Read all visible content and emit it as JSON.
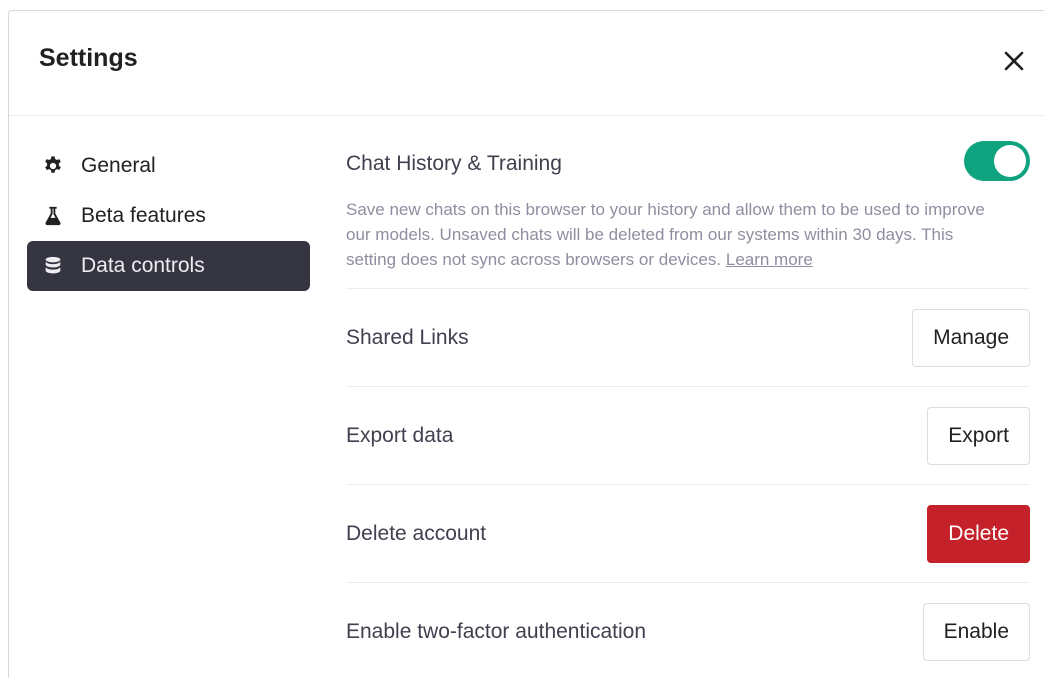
{
  "dialog": {
    "title": "Settings",
    "close_icon": "close-icon"
  },
  "sidebar": {
    "items": [
      {
        "label": "General",
        "icon": "gear-icon",
        "active": false
      },
      {
        "label": "Beta features",
        "icon": "flask-icon",
        "active": false
      },
      {
        "label": "Data controls",
        "icon": "database-icon",
        "active": true
      }
    ]
  },
  "main": {
    "chat_history": {
      "label": "Chat History & Training",
      "toggle_on": true,
      "description": "Save new chats on this browser to your history and allow them to be used to improve our models. Unsaved chats will be deleted from our systems within 30 days. This setting does not sync across browsers or devices.",
      "learn_more": "Learn more"
    },
    "rows": [
      {
        "label": "Shared Links",
        "button": "Manage"
      },
      {
        "label": "Export data",
        "button": "Export"
      },
      {
        "label": "Delete account",
        "button": "Delete"
      },
      {
        "label": "Enable two-factor authentication",
        "button": "Enable"
      }
    ]
  },
  "colors": {
    "accent_green": "#10a37f",
    "danger_red": "#c4212a",
    "active_nav": "#343541"
  }
}
